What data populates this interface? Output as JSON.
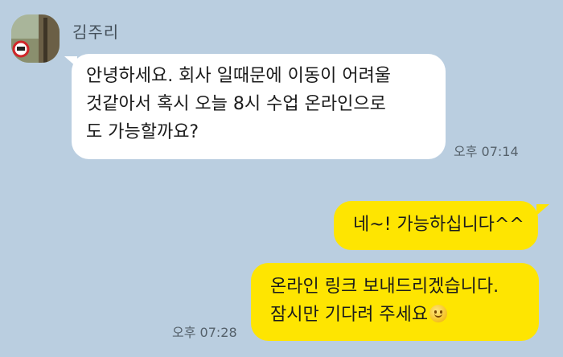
{
  "sender": {
    "name": "김주리",
    "avatar_icon": "profile-photo-icon"
  },
  "messages": [
    {
      "direction": "incoming",
      "lines": [
        "안녕하세요. 회사 일때문에 이동이 어려울",
        "것같아서 혹시 오늘 8시 수업 온라인으로",
        "도 가능할까요?"
      ],
      "time": "오후 07:14"
    },
    {
      "direction": "outgoing",
      "lines": [
        "네~! 가능하십니다^^"
      ]
    },
    {
      "direction": "outgoing",
      "lines": [
        "온라인 링크 보내드리겠습니다.",
        "잠시만 기다려 주세요"
      ],
      "emoji": "smiling-face-icon",
      "time": "오후 07:28"
    }
  ],
  "colors": {
    "background": "#bacee0",
    "incoming_bubble": "#ffffff",
    "outgoing_bubble": "#fee501"
  }
}
